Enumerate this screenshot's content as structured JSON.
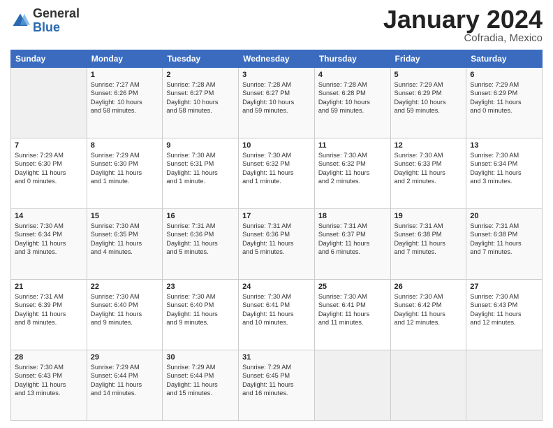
{
  "logo": {
    "general": "General",
    "blue": "Blue"
  },
  "header": {
    "month": "January 2024",
    "location": "Cofradia, Mexico"
  },
  "days_header": [
    "Sunday",
    "Monday",
    "Tuesday",
    "Wednesday",
    "Thursday",
    "Friday",
    "Saturday"
  ],
  "weeks": [
    [
      {
        "day": "",
        "info": ""
      },
      {
        "day": "1",
        "info": "Sunrise: 7:27 AM\nSunset: 6:26 PM\nDaylight: 10 hours\nand 58 minutes."
      },
      {
        "day": "2",
        "info": "Sunrise: 7:28 AM\nSunset: 6:27 PM\nDaylight: 10 hours\nand 58 minutes."
      },
      {
        "day": "3",
        "info": "Sunrise: 7:28 AM\nSunset: 6:27 PM\nDaylight: 10 hours\nand 59 minutes."
      },
      {
        "day": "4",
        "info": "Sunrise: 7:28 AM\nSunset: 6:28 PM\nDaylight: 10 hours\nand 59 minutes."
      },
      {
        "day": "5",
        "info": "Sunrise: 7:29 AM\nSunset: 6:29 PM\nDaylight: 10 hours\nand 59 minutes."
      },
      {
        "day": "6",
        "info": "Sunrise: 7:29 AM\nSunset: 6:29 PM\nDaylight: 11 hours\nand 0 minutes."
      }
    ],
    [
      {
        "day": "7",
        "info": "Sunrise: 7:29 AM\nSunset: 6:30 PM\nDaylight: 11 hours\nand 0 minutes."
      },
      {
        "day": "8",
        "info": "Sunrise: 7:29 AM\nSunset: 6:30 PM\nDaylight: 11 hours\nand 1 minute."
      },
      {
        "day": "9",
        "info": "Sunrise: 7:30 AM\nSunset: 6:31 PM\nDaylight: 11 hours\nand 1 minute."
      },
      {
        "day": "10",
        "info": "Sunrise: 7:30 AM\nSunset: 6:32 PM\nDaylight: 11 hours\nand 1 minute."
      },
      {
        "day": "11",
        "info": "Sunrise: 7:30 AM\nSunset: 6:32 PM\nDaylight: 11 hours\nand 2 minutes."
      },
      {
        "day": "12",
        "info": "Sunrise: 7:30 AM\nSunset: 6:33 PM\nDaylight: 11 hours\nand 2 minutes."
      },
      {
        "day": "13",
        "info": "Sunrise: 7:30 AM\nSunset: 6:34 PM\nDaylight: 11 hours\nand 3 minutes."
      }
    ],
    [
      {
        "day": "14",
        "info": "Sunrise: 7:30 AM\nSunset: 6:34 PM\nDaylight: 11 hours\nand 3 minutes."
      },
      {
        "day": "15",
        "info": "Sunrise: 7:30 AM\nSunset: 6:35 PM\nDaylight: 11 hours\nand 4 minutes."
      },
      {
        "day": "16",
        "info": "Sunrise: 7:31 AM\nSunset: 6:36 PM\nDaylight: 11 hours\nand 5 minutes."
      },
      {
        "day": "17",
        "info": "Sunrise: 7:31 AM\nSunset: 6:36 PM\nDaylight: 11 hours\nand 5 minutes."
      },
      {
        "day": "18",
        "info": "Sunrise: 7:31 AM\nSunset: 6:37 PM\nDaylight: 11 hours\nand 6 minutes."
      },
      {
        "day": "19",
        "info": "Sunrise: 7:31 AM\nSunset: 6:38 PM\nDaylight: 11 hours\nand 7 minutes."
      },
      {
        "day": "20",
        "info": "Sunrise: 7:31 AM\nSunset: 6:38 PM\nDaylight: 11 hours\nand 7 minutes."
      }
    ],
    [
      {
        "day": "21",
        "info": "Sunrise: 7:31 AM\nSunset: 6:39 PM\nDaylight: 11 hours\nand 8 minutes."
      },
      {
        "day": "22",
        "info": "Sunrise: 7:30 AM\nSunset: 6:40 PM\nDaylight: 11 hours\nand 9 minutes."
      },
      {
        "day": "23",
        "info": "Sunrise: 7:30 AM\nSunset: 6:40 PM\nDaylight: 11 hours\nand 9 minutes."
      },
      {
        "day": "24",
        "info": "Sunrise: 7:30 AM\nSunset: 6:41 PM\nDaylight: 11 hours\nand 10 minutes."
      },
      {
        "day": "25",
        "info": "Sunrise: 7:30 AM\nSunset: 6:41 PM\nDaylight: 11 hours\nand 11 minutes."
      },
      {
        "day": "26",
        "info": "Sunrise: 7:30 AM\nSunset: 6:42 PM\nDaylight: 11 hours\nand 12 minutes."
      },
      {
        "day": "27",
        "info": "Sunrise: 7:30 AM\nSunset: 6:43 PM\nDaylight: 11 hours\nand 12 minutes."
      }
    ],
    [
      {
        "day": "28",
        "info": "Sunrise: 7:30 AM\nSunset: 6:43 PM\nDaylight: 11 hours\nand 13 minutes."
      },
      {
        "day": "29",
        "info": "Sunrise: 7:29 AM\nSunset: 6:44 PM\nDaylight: 11 hours\nand 14 minutes."
      },
      {
        "day": "30",
        "info": "Sunrise: 7:29 AM\nSunset: 6:44 PM\nDaylight: 11 hours\nand 15 minutes."
      },
      {
        "day": "31",
        "info": "Sunrise: 7:29 AM\nSunset: 6:45 PM\nDaylight: 11 hours\nand 16 minutes."
      },
      {
        "day": "",
        "info": ""
      },
      {
        "day": "",
        "info": ""
      },
      {
        "day": "",
        "info": ""
      }
    ]
  ]
}
